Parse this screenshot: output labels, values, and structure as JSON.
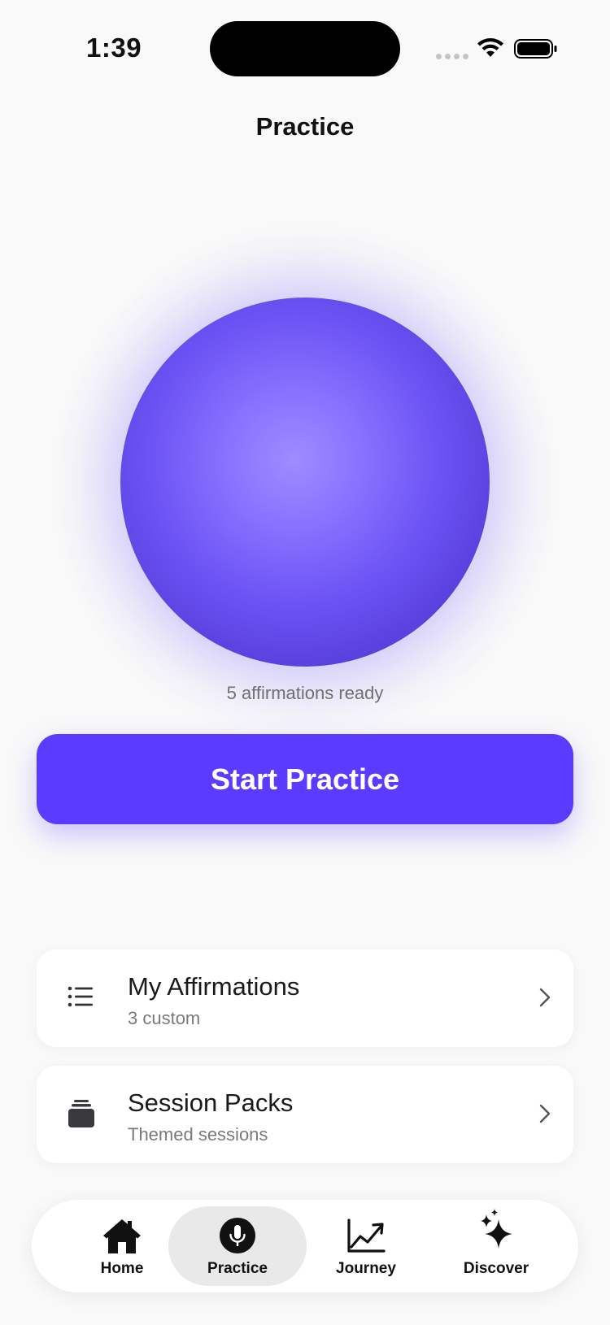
{
  "status_bar": {
    "time": "1:39"
  },
  "header": {
    "title": "Practice"
  },
  "orb": {
    "caption": "5 affirmations ready"
  },
  "primary_action": {
    "label": "Start Practice"
  },
  "cards": [
    {
      "title": "My Affirmations",
      "subtitle": "3 custom",
      "icon": "list-icon"
    },
    {
      "title": "Session Packs",
      "subtitle": "Themed sessions",
      "icon": "stack-icon"
    }
  ],
  "tab_bar": {
    "tabs": [
      {
        "label": "Home",
        "icon": "house-icon",
        "active": false
      },
      {
        "label": "Practice",
        "icon": "microphone-icon",
        "active": true
      },
      {
        "label": "Journey",
        "icon": "chart-line-icon",
        "active": false
      },
      {
        "label": "Discover",
        "icon": "sparkles-icon",
        "active": false
      }
    ]
  },
  "colors": {
    "accent": "#5b3bff",
    "orb": "#6b52f4",
    "background": "#f9f9f9"
  }
}
